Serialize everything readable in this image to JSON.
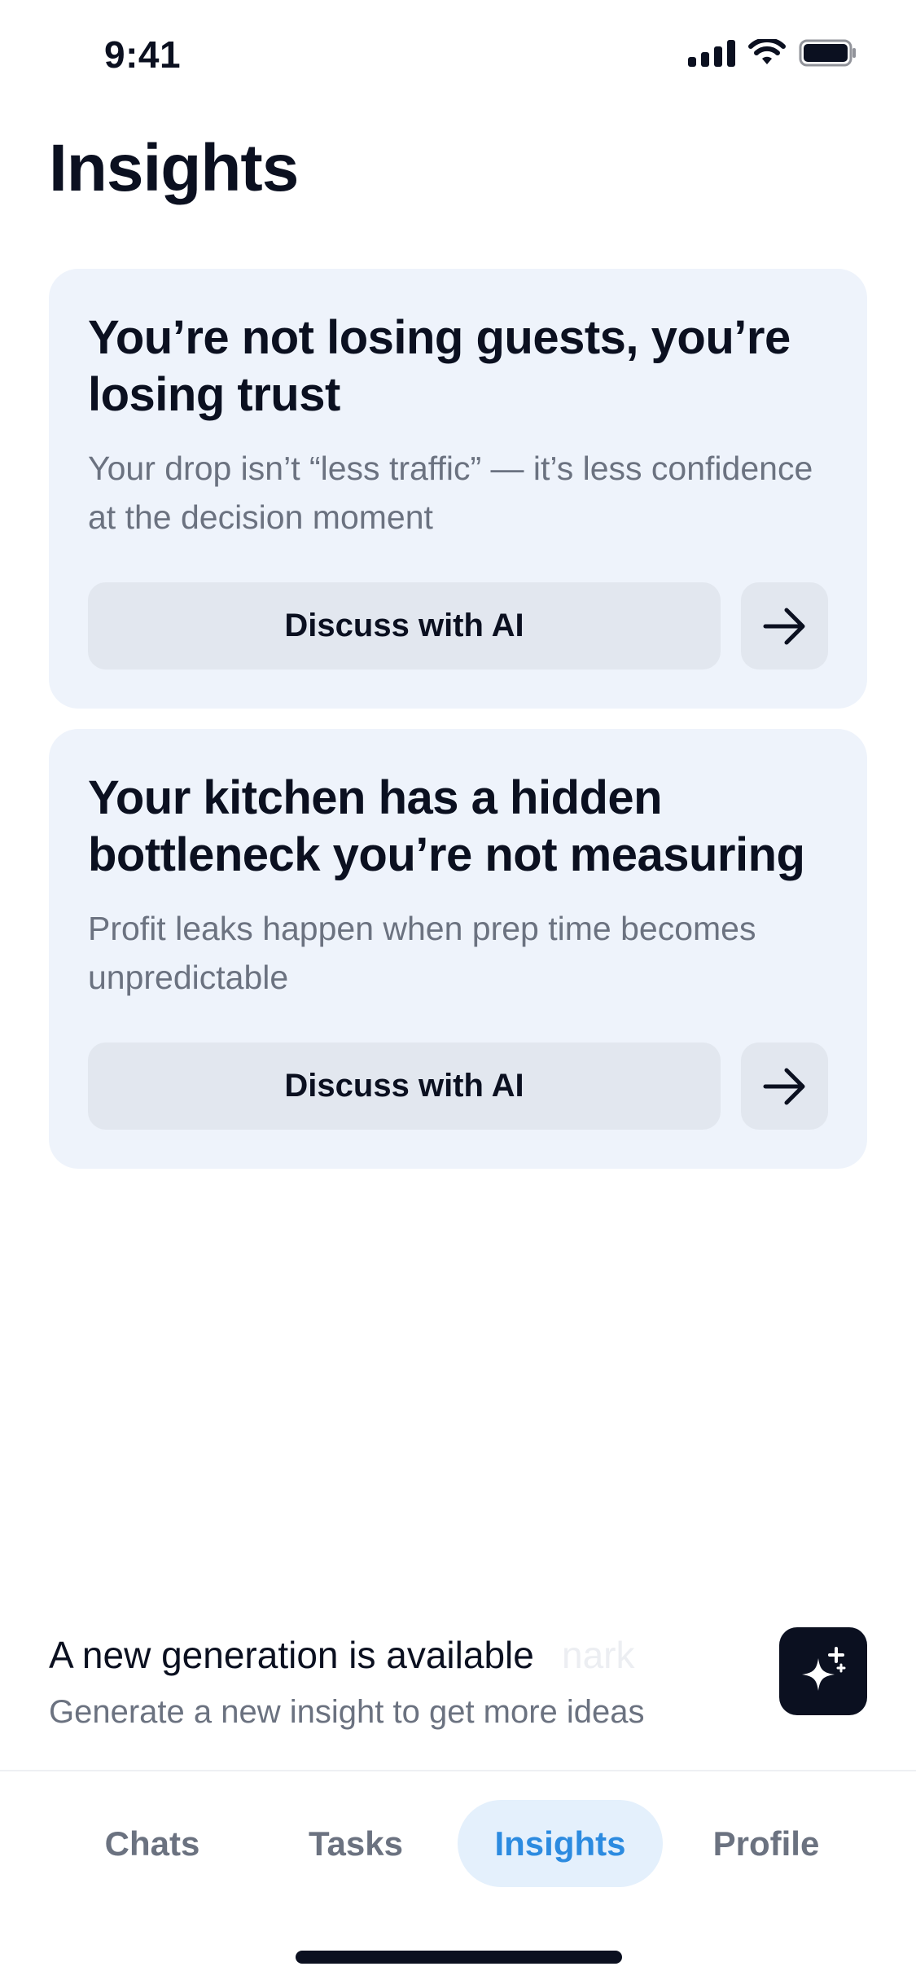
{
  "status_bar": {
    "time": "9:41"
  },
  "page": {
    "title": "Insights"
  },
  "cards": [
    {
      "title": "You’re not losing guests, you’re losing trust",
      "subtitle": "Your drop isn’t “less traffic” — it’s less confidence at the decision moment",
      "button_label": "Discuss with AI",
      "arrow_icon": "arrow-right-icon"
    },
    {
      "title": "Your kitchen has a hidden bottleneck you’re not measuring",
      "subtitle": "Profit leaks happen when prep time becomes unpredictable",
      "button_label": "Discuss with AI",
      "arrow_icon": "arrow-right-icon"
    }
  ],
  "generation": {
    "title": "A new generation is available",
    "ghost_text": "nark",
    "subtitle": "Generate a new insight to get more ideas",
    "icon": "sparkle-icon"
  },
  "tabs": [
    {
      "label": "Chats",
      "active": false
    },
    {
      "label": "Tasks",
      "active": false
    },
    {
      "label": "Insights",
      "active": true
    },
    {
      "label": "Profile",
      "active": false
    }
  ],
  "colors": {
    "accent": "#2c8be0",
    "accent_bg": "#e4f0fc",
    "card_bg": "#eef3fb",
    "button_bg": "#e2e7ef",
    "text_primary": "#0b1020",
    "text_secondary": "#6b7280"
  }
}
